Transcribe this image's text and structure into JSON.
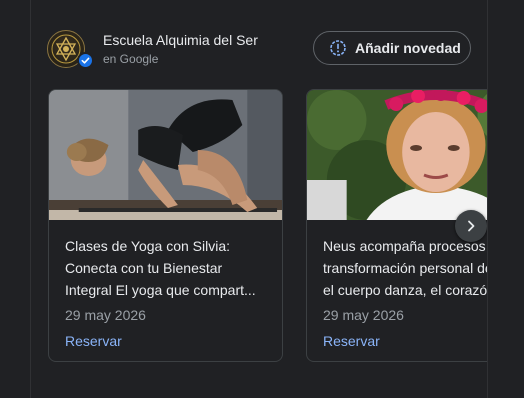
{
  "business": {
    "name": "Escuela Alquimia del Ser",
    "subtitle": "en Google"
  },
  "actions": {
    "add_update_label": "Añadir novedad"
  },
  "posts": [
    {
      "title": "Clases de Yoga con Silvia:\nConecta con tu Bienestar\nIntegral El yoga que compart...",
      "date": "29 may 2026",
      "cta": "Reservar"
    },
    {
      "title": "Neus acompaña procesos\ntransformación personal de\nel cuerpo danza, el corazón",
      "date": "29 may 2026",
      "cta": "Reservar"
    }
  ],
  "icons": {
    "logo": "seal-logo-icon",
    "verified": "verified-check-icon",
    "add_update": "info-circle-icon",
    "next": "chevron-right-icon"
  },
  "colors": {
    "background": "#202124",
    "link": "#8ab4f8",
    "verified": "#1a73e8"
  }
}
